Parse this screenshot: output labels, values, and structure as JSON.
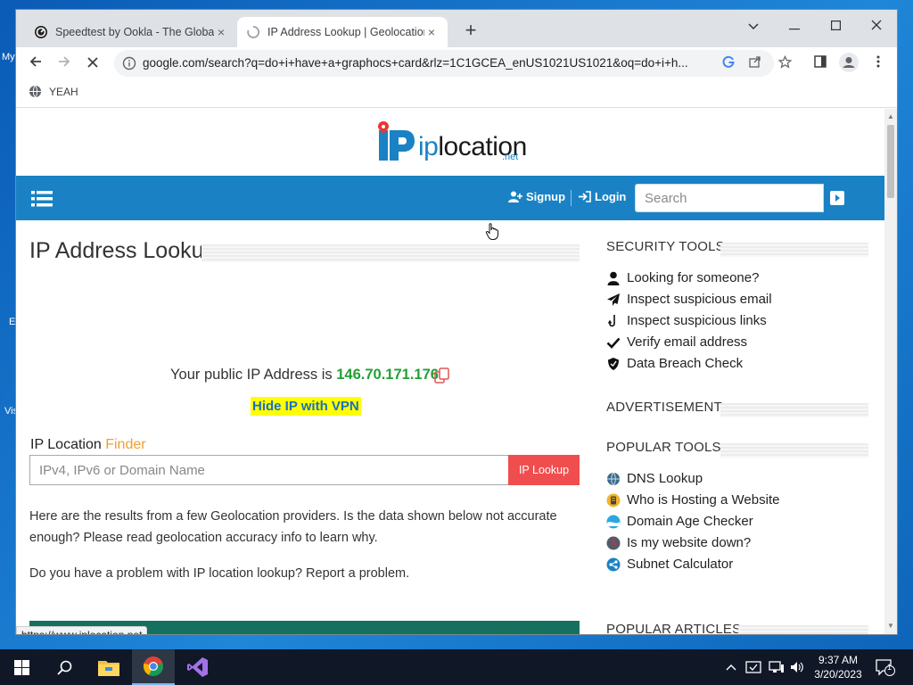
{
  "desktop": {
    "frag1": "My",
    "frag2": "E",
    "frag3": "Vis"
  },
  "browser": {
    "tabs": [
      {
        "title": "Speedtest by Ookla - The Global",
        "close": "×"
      },
      {
        "title": "IP Address Lookup | Geolocation",
        "close": "×"
      }
    ],
    "new_tab": "+",
    "url": "google.com/search?q=do+i+have+a+graphocs+card&rlz=1C1GCEA_enUS1021US1021&oq=do+i+h...",
    "bookmark": "YEAH",
    "status_url": "https://www.iplocation.net"
  },
  "site": {
    "logo_ip": "ip",
    "logo_rest": "location",
    "logo_net": ".net",
    "nav": {
      "signup": "Signup",
      "login": "Login",
      "search_placeholder": "Search"
    },
    "main": {
      "title": "IP Address Lookup",
      "ip_prefix": "Your public IP Address is ",
      "ip_value": "146.70.171.176",
      "vpn_link": "Hide IP with VPN",
      "finder_label": "IP Location ",
      "finder_accent": "Finder",
      "finder_placeholder": "IPv4, IPv6 or Domain Name",
      "finder_button": "IP Lookup",
      "para1": "Here are the results from a few Geolocation providers. Is the data shown below not accurate enough? Please read geolocation accuracy info to learn why.",
      "para2": "Do you have a problem with IP location lookup? Report a problem."
    },
    "sidebar": {
      "security_heading": "SECURITY TOOLS",
      "security_items": [
        "Looking for someone?",
        "Inspect suspicious email",
        "Inspect suspicious links",
        "Verify email address",
        "Data Breach Check"
      ],
      "ad_heading": "ADVERTISEMENT",
      "popular_heading": "POPULAR TOOLS",
      "popular_items": [
        "DNS Lookup",
        "Who is Hosting a Website",
        "Domain Age Checker",
        "Is my website down?",
        "Subnet Calculator"
      ],
      "articles_heading": "POPULAR ARTICLES"
    }
  },
  "taskbar": {
    "time": "9:37 AM",
    "date": "3/20/2023",
    "notif_count": "1"
  },
  "colors": {
    "brand_blue": "#1a82c4",
    "ip_green": "#23a036",
    "lookup_red": "#f04e4e",
    "finder_orange": "#f0a030"
  }
}
